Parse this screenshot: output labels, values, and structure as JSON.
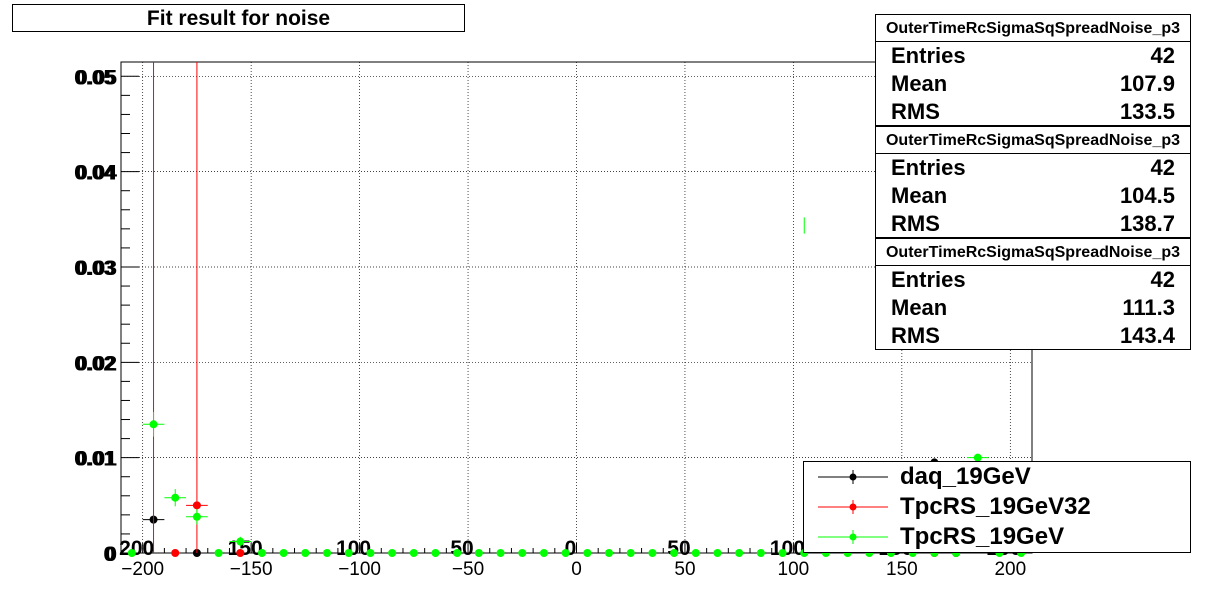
{
  "plot_title": "Fit result for noise",
  "stats_boxes": [
    {
      "title": "OuterTimeRcSigmaSqSpreadNoise_p3",
      "entries_label": "Entries",
      "entries": "42",
      "mean_label": "Mean",
      "mean": "107.9",
      "rms_label": "RMS",
      "rms": "133.5"
    },
    {
      "title": "OuterTimeRcSigmaSqSpreadNoise_p3",
      "entries_label": "Entries",
      "entries": "42",
      "mean_label": "Mean",
      "mean": "104.5",
      "rms_label": "RMS",
      "rms": "138.7"
    },
    {
      "title": "OuterTimeRcSigmaSqSpreadNoise_p3",
      "entries_label": "Entries",
      "entries": "42",
      "mean_label": "Mean",
      "mean": "111.3",
      "rms_label": "RMS",
      "rms": "143.4"
    }
  ],
  "legend": [
    {
      "label": "daq_19GeV",
      "color": "#000000"
    },
    {
      "label": "TpcRS_19GeV32",
      "color": "#ff0000"
    },
    {
      "label": "TpcRS_19GeV",
      "color": "#00ff00"
    }
  ],
  "chart_data": {
    "type": "scatter",
    "title": "Fit result for noise",
    "xlabel": "",
    "ylabel": "",
    "xlim": [
      -210,
      210
    ],
    "ylim": [
      0,
      0.0515
    ],
    "grid": true,
    "legend_position": "bottom-right",
    "x_ticks": [
      -200,
      -150,
      -100,
      -50,
      0,
      50,
      100,
      150,
      200
    ],
    "x_tick_labels": [
      "−200",
      "−150",
      "−100",
      "−50",
      "0",
      "50",
      "100",
      "150",
      "200"
    ],
    "x_tick_labels_overlay": [
      "200",
      "150",
      "100",
      "50",
      "0",
      "50",
      "100",
      "150",
      "200"
    ],
    "y_ticks": [
      0,
      0.01,
      0.02,
      0.03,
      0.04,
      0.05
    ],
    "y_tick_labels": [
      "0",
      "0.01",
      "0.02",
      "0.03",
      "0.04",
      "0.05"
    ],
    "series": [
      {
        "name": "daq_19GeV",
        "color": "#000000",
        "points": [
          {
            "x": -195,
            "y": 0.0035
          },
          {
            "x": -175,
            "y": 0.0
          },
          {
            "x": 165,
            "y": 0.0095
          },
          {
            "x": 175,
            "y": 0.0
          }
        ],
        "error_bars": [
          {
            "x": -195,
            "y": 0.0035,
            "xerr": 5,
            "yerr": 0.0
          }
        ]
      },
      {
        "name": "TpcRS_19GeV32",
        "color": "#ff0000",
        "points": [
          {
            "x": -185,
            "y": 0.0
          },
          {
            "x": -175,
            "y": 0.005
          },
          {
            "x": -155,
            "y": 0.0
          },
          {
            "x": 165,
            "y": 0.0
          }
        ],
        "vertical_lines_x": [
          -195,
          -175
        ],
        "error_bars": [
          {
            "x": -175,
            "y": 0.005,
            "xerr": 5,
            "yerr": 0.0
          }
        ]
      },
      {
        "name": "TpcRS_19GeV",
        "color": "#00ff00",
        "points": [
          {
            "x": -205,
            "y": 0.0
          },
          {
            "x": -195,
            "y": 0.0135
          },
          {
            "x": -185,
            "y": 0.0058
          },
          {
            "x": -175,
            "y": 0.0038
          },
          {
            "x": -165,
            "y": 0.0
          },
          {
            "x": -155,
            "y": 0.0012
          },
          {
            "x": -145,
            "y": 0.0
          },
          {
            "x": -135,
            "y": 0.0
          },
          {
            "x": -125,
            "y": 0.0
          },
          {
            "x": -115,
            "y": 0.0
          },
          {
            "x": -105,
            "y": 0.0
          },
          {
            "x": -95,
            "y": 0.0
          },
          {
            "x": -85,
            "y": 0.0
          },
          {
            "x": -75,
            "y": 0.0
          },
          {
            "x": -65,
            "y": 0.0
          },
          {
            "x": -55,
            "y": 0.0
          },
          {
            "x": -45,
            "y": 0.0
          },
          {
            "x": -35,
            "y": 0.0
          },
          {
            "x": -25,
            "y": 0.0
          },
          {
            "x": -15,
            "y": 0.0
          },
          {
            "x": -5,
            "y": 0.0
          },
          {
            "x": 5,
            "y": 0.0
          },
          {
            "x": 15,
            "y": 0.0
          },
          {
            "x": 25,
            "y": 0.0
          },
          {
            "x": 35,
            "y": 0.0
          },
          {
            "x": 45,
            "y": 0.0
          },
          {
            "x": 55,
            "y": 0.0
          },
          {
            "x": 65,
            "y": 0.0
          },
          {
            "x": 75,
            "y": 0.0
          },
          {
            "x": 85,
            "y": 0.0
          },
          {
            "x": 95,
            "y": 0.0
          },
          {
            "x": 105,
            "y": 0.0
          },
          {
            "x": 115,
            "y": 0.0
          },
          {
            "x": 125,
            "y": 0.0
          },
          {
            "x": 135,
            "y": 0.0
          },
          {
            "x": 145,
            "y": 0.0
          },
          {
            "x": 155,
            "y": 0.0
          },
          {
            "x": 165,
            "y": 0.0
          },
          {
            "x": 175,
            "y": 0.0
          },
          {
            "x": 185,
            "y": 0.01
          },
          {
            "x": 195,
            "y": 0.0
          },
          {
            "x": 205,
            "y": 0.0
          }
        ],
        "error_bars": [
          {
            "x": -195,
            "y": 0.0135,
            "xerr": 5,
            "yerr": 0.0013
          },
          {
            "x": -185,
            "y": 0.0058,
            "xerr": 5,
            "yerr": 0.0009
          },
          {
            "x": -175,
            "y": 0.0038,
            "xerr": 5,
            "yerr": 0.0008
          },
          {
            "x": -155,
            "y": 0.0012,
            "xerr": 5,
            "yerr": 0.0005
          },
          {
            "x": 185,
            "y": 0.01,
            "xerr": 5,
            "yerr": 0.0
          }
        ],
        "extra_vertical_ticks": [
          {
            "x": 105,
            "y0": 0.0335,
            "y1": 0.0352
          }
        ]
      }
    ]
  }
}
